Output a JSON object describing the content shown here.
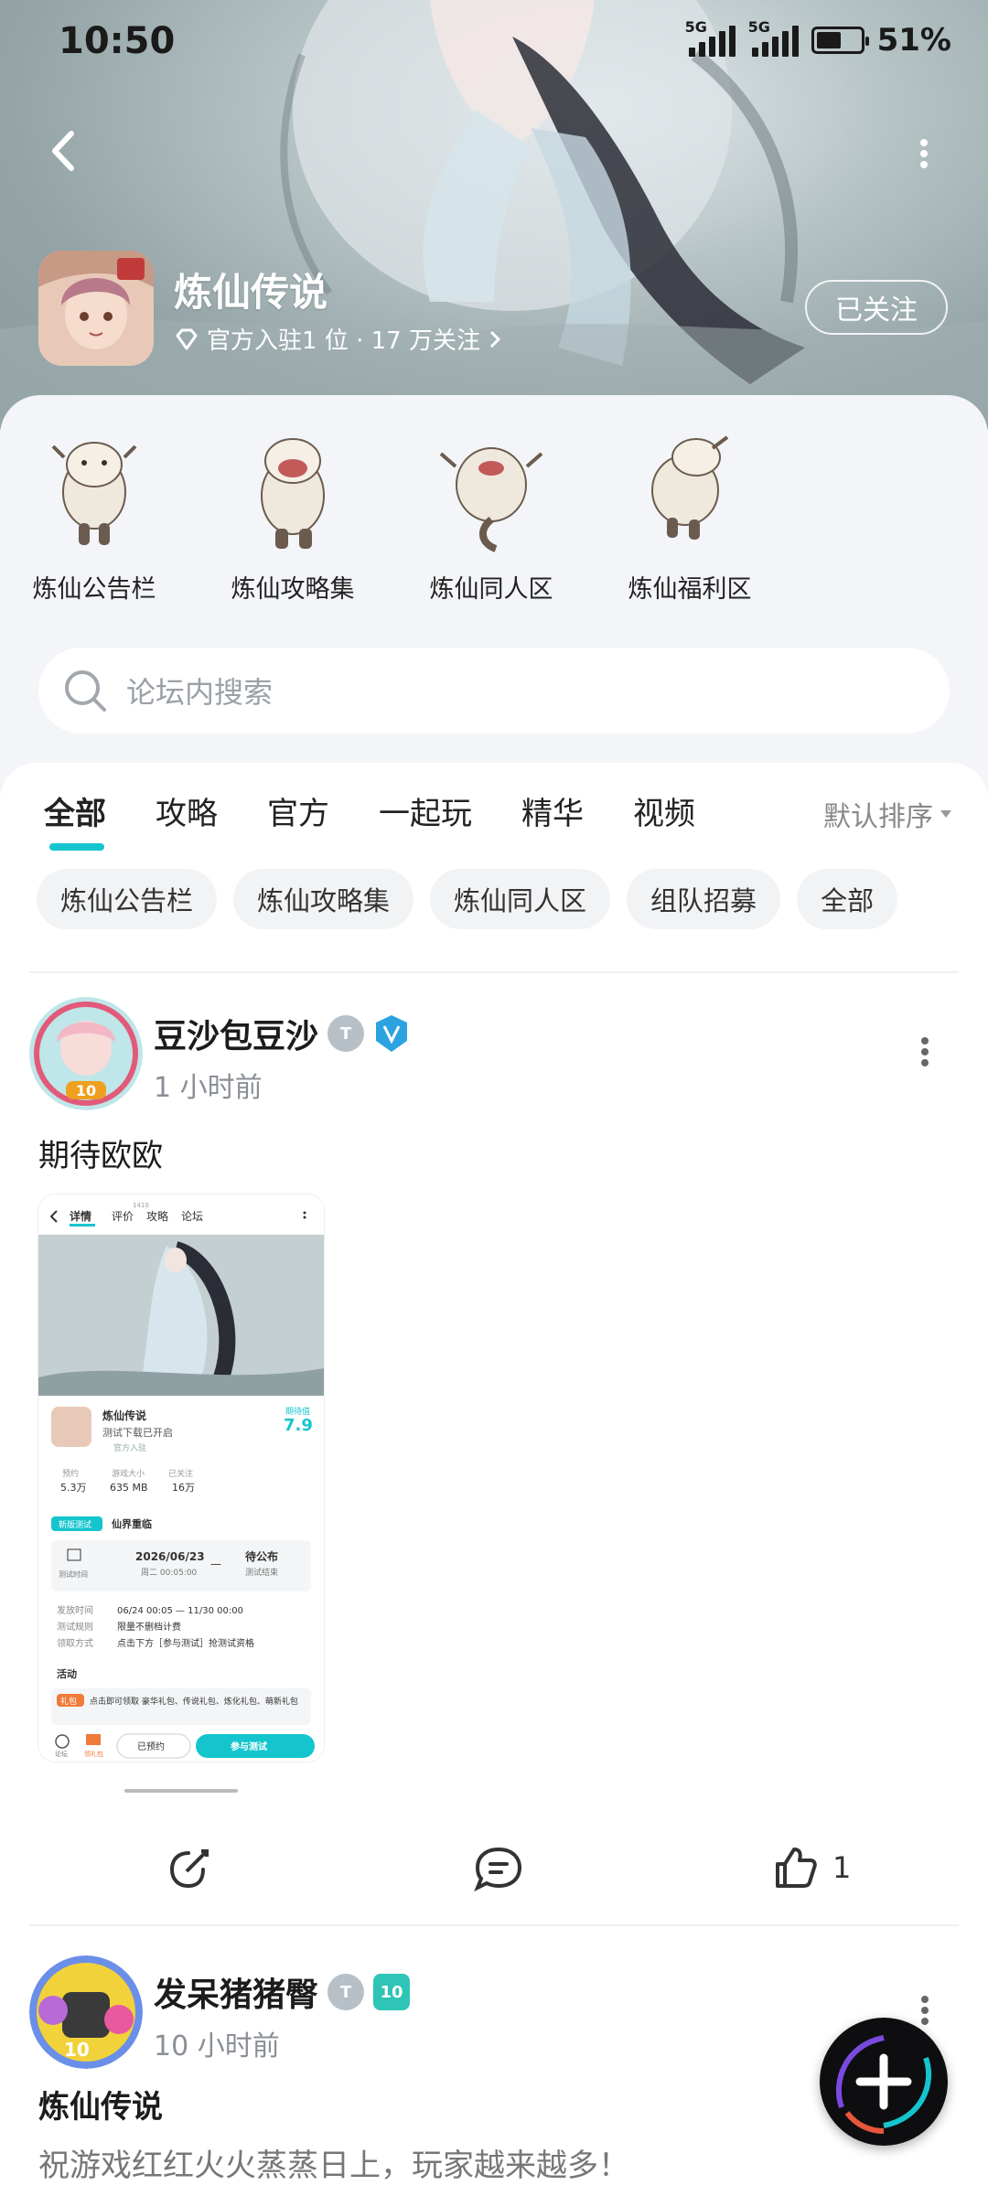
{
  "status": {
    "time": "10:50",
    "net1": "5G",
    "net2": "5G",
    "battery": "51%",
    "battery_level": 0.51
  },
  "header": {
    "title": "炼仙传说",
    "subtitle": "官方入驻1 位 · 17 万关注",
    "follow_label": "已关注"
  },
  "zones": [
    {
      "label": "炼仙公告栏"
    },
    {
      "label": "炼仙攻略集"
    },
    {
      "label": "炼仙同人区"
    },
    {
      "label": "炼仙福利区"
    }
  ],
  "search": {
    "placeholder": "论坛内搜索"
  },
  "tabs": [
    "全部",
    "攻略",
    "官方",
    "一起玩",
    "精华",
    "视频"
  ],
  "sort_label": "默认排序",
  "chips": [
    "炼仙公告栏",
    "炼仙攻略集",
    "炼仙同人区",
    "组队招募",
    "全部"
  ],
  "posts": [
    {
      "username": "豆沙包豆沙",
      "time": "1 小时前",
      "text": "期待欧欧",
      "avatar_badge": "10",
      "like_count": "1",
      "screenshot": {
        "tabs": [
          "详情",
          "评价",
          "攻略",
          "论坛"
        ],
        "review_count": "1410",
        "game_name": "炼仙传说",
        "status": "测试下载已开启",
        "official": "官方入驻",
        "score_label": "期待值",
        "score": "7.9",
        "stats": [
          {
            "label": "预约",
            "value": "5.3万"
          },
          {
            "label": "游戏大小",
            "value": "635 MB"
          },
          {
            "label": "已关注",
            "value": "16万"
          }
        ],
        "test_tag": "新版测试",
        "test_name": "仙界重临",
        "test_time_label": "测试时间",
        "test_start_date": "2026/06/23",
        "test_start_detail": "周二 00:05:00",
        "test_end": "待公布",
        "test_end_detail": "测试结束",
        "info": [
          {
            "k": "发放时间",
            "v": "06/24 00:05 — 11/30 00:00"
          },
          {
            "k": "测试规则",
            "v": "限量不删档计费"
          },
          {
            "k": "领取方式",
            "v": "点击下方［参与测试］抢测试资格"
          }
        ],
        "activity": "活动",
        "gift_tag": "礼包",
        "gift_text": "点击即可领取 豪华礼包、传说礼包、炼化礼包、萌新礼包",
        "forum_label": "论坛",
        "gift_label": "领礼包",
        "reserved_label": "已预约",
        "join_label": "参与测试"
      }
    },
    {
      "username": "发呆猪猪臀",
      "time": "10 小时前",
      "avatar_badge": "10",
      "level_badge": "10",
      "title": "炼仙传说",
      "text": "祝游戏红红火火蒸蒸日上，玩家越来越多！"
    }
  ],
  "colors": {
    "accent": "#15c5ce",
    "fab": "#0e0e10"
  }
}
